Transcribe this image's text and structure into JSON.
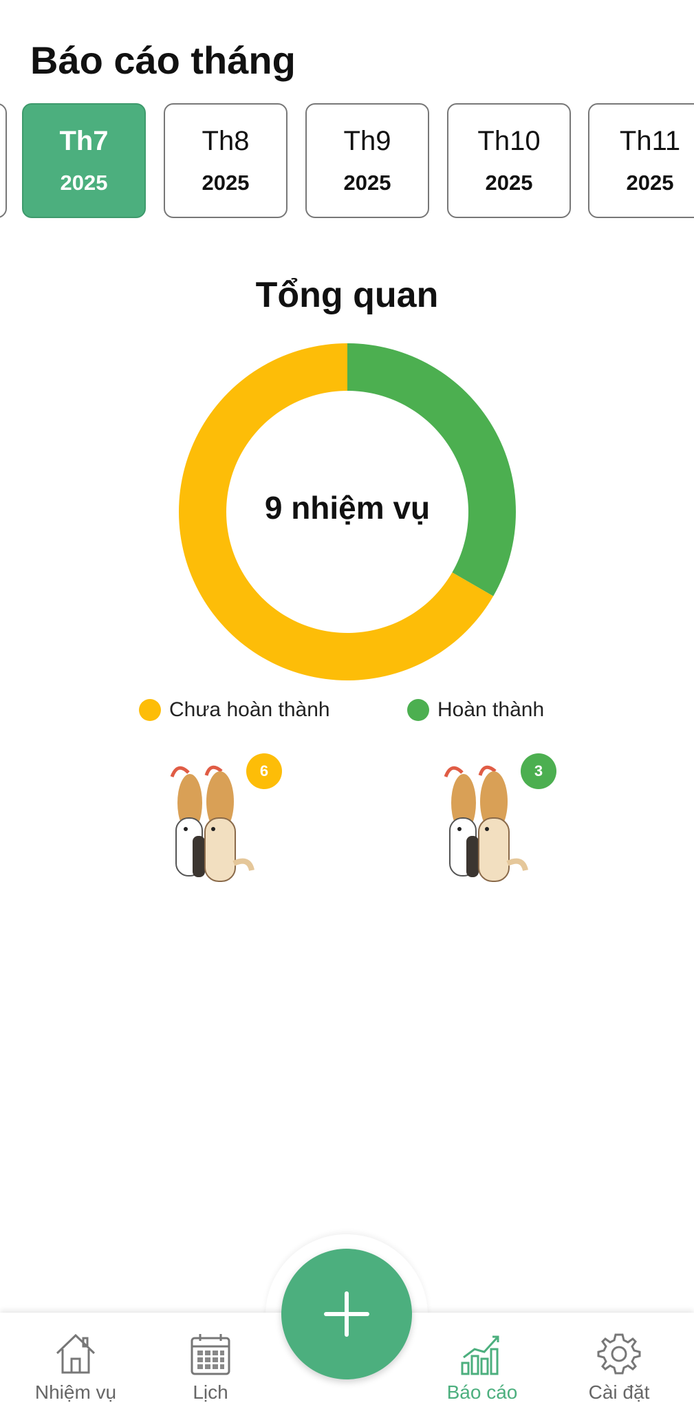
{
  "page_title": "Báo cáo tháng",
  "months": [
    {
      "name": "Th7",
      "year": "2025",
      "selected": true
    },
    {
      "name": "Th8",
      "year": "2025",
      "selected": false
    },
    {
      "name": "Th9",
      "year": "2025",
      "selected": false
    },
    {
      "name": "Th10",
      "year": "2025",
      "selected": false
    },
    {
      "name": "Th11",
      "year": "2025",
      "selected": false
    }
  ],
  "overview": {
    "title": "Tổng quan",
    "center_label": "9 nhiệm vụ"
  },
  "chart_data": {
    "type": "pie",
    "title": "Tổng quan",
    "slices": [
      {
        "name": "Hoàn thành",
        "value": 3,
        "color": "#4caf50"
      },
      {
        "name": "Chưa hoàn thành",
        "value": 6,
        "color": "#fdbd08"
      }
    ],
    "total": 9,
    "legend_placement": "bottom"
  },
  "legend": [
    {
      "label": "Chưa hoàn thành",
      "color": "#fdbd08"
    },
    {
      "label": "Hoàn thành",
      "color": "#4caf50"
    }
  ],
  "counts": {
    "incomplete": "6",
    "complete": "3"
  },
  "nav": {
    "items": [
      {
        "label": "Nhiệm vụ",
        "icon": "home-icon"
      },
      {
        "label": "Lịch",
        "icon": "calendar-icon"
      },
      {
        "label": "Báo cáo",
        "icon": "bar-chart-icon",
        "active": true
      },
      {
        "label": "Cài đặt",
        "icon": "gear-icon"
      }
    ],
    "fab_icon": "plus-icon"
  },
  "colors": {
    "accent": "#4caf7e",
    "complete": "#4caf50",
    "incomplete": "#fdbd08"
  }
}
